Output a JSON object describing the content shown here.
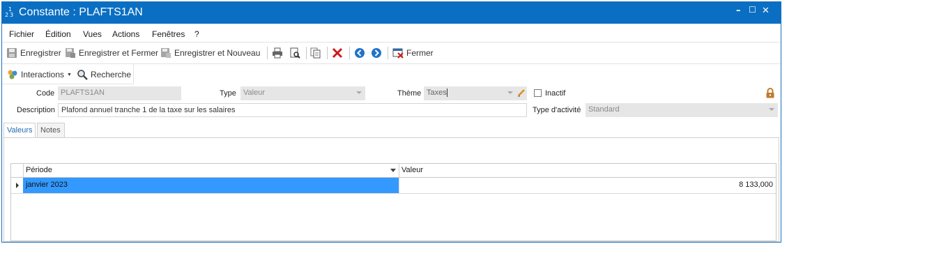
{
  "window": {
    "title": "Constante : PLAFTS1AN",
    "icon_text_top": "1",
    "icon_text_bottom": "23",
    "controls": {
      "minimize": "–",
      "maximize": "☐",
      "close": "✕"
    }
  },
  "menubar": {
    "items": [
      "Fichier",
      "Édition",
      "Vues",
      "Actions",
      "Fenêtres",
      "?"
    ]
  },
  "toolbar": {
    "save_label": "Enregistrer",
    "save_close_label": "Enregistrer et Fermer",
    "save_new_label": "Enregistrer et Nouveau",
    "close_label": "Fermer"
  },
  "toolbar2": {
    "interactions_label": "Interactions",
    "search_label": "Recherche"
  },
  "form": {
    "code_label": "Code",
    "code_value": "PLAFTS1AN",
    "type_label": "Type",
    "type_value": "Valeur",
    "theme_label": "Thème",
    "theme_value": "Taxes",
    "inactive_label": "Inactif",
    "inactive_checked": false,
    "description_label": "Description",
    "description_value": "Plafond annuel tranche 1 de la taxe sur les salaires",
    "activity_type_label": "Type d'activité",
    "activity_type_value": "Standard"
  },
  "tabs": [
    {
      "label": "Valeurs",
      "active": true
    },
    {
      "label": "Notes",
      "active": false
    }
  ],
  "grid": {
    "columns": [
      "Période",
      "Valeur"
    ],
    "rows": [
      {
        "periode": "janvier 2023",
        "valeur": "8 133,000"
      }
    ]
  },
  "colors": {
    "titlebar": "#0a6fc2",
    "selection": "#3399ff",
    "tab_active_text": "#1f6bb5",
    "delete_red": "#d01919",
    "nav_blue": "#1f73c9",
    "lock": "#c07a2c"
  }
}
